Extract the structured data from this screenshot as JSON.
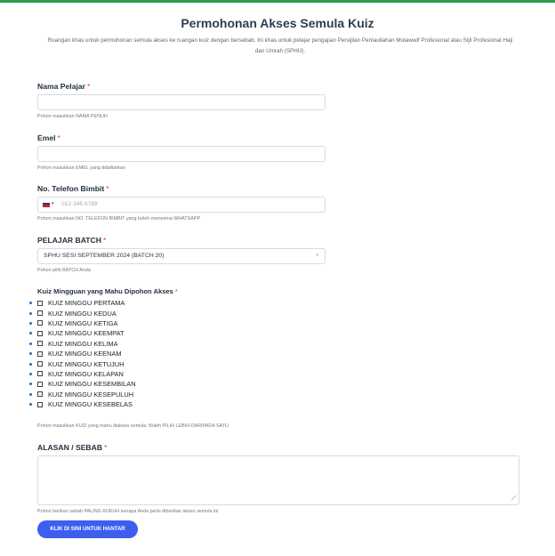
{
  "form": {
    "title": "Permohonan Akses Semula Kuiz",
    "intro": "Ruangan khas untuk permohonan semula akses ke ruangan kuiz dengan bersebab. Ini khas untuk pelajar pengajian Persijilan Pentauliahan Mutawwif Profesional atau Sijil Profesional Haji dan Umrah (SPHU)."
  },
  "fields": {
    "nama": {
      "label": "Nama Pelajar",
      "required": "*",
      "hint": "Pohon masukkan NAMA PENUH",
      "value": ""
    },
    "emel": {
      "label": "Emel",
      "required": "*",
      "hint": "Pohon masukkan EMEL yang didaftarkan",
      "value": ""
    },
    "telefon": {
      "label": "No. Telefon Bimbit",
      "required": "*",
      "placeholder": "012-345 6789",
      "country": "MY",
      "hint": "Pohon masukkan NO. TELEFON BIMBIT yang boleh menerima WHATSAPP"
    },
    "batch": {
      "label": "PELAJAR BATCH",
      "required": "*",
      "selected": "SPHU SESI SEPTEMBER 2024 (BATCH 20)",
      "hint": "Pohon pilih BATCH Anda"
    },
    "kuiz": {
      "label": "Kuiz Mingguan yang Mahu Dipohon Akses",
      "required": "*",
      "options": [
        "KUIZ MINGGU PERTAMA",
        "KUIZ MINGGU KEDUA",
        "KUIZ MINGGU KETIGA",
        "KUIZ MINGGU KEEMPAT",
        "KUIZ MINGGU KELIMA",
        "KUIZ MINGGU KEENAM",
        "KUIZ MINGGU KETUJUH",
        "KUIZ MINGGU KELAPAN",
        "KUIZ MINGGU KESEMBILAN",
        "KUIZ MINGGU KESEPULUH",
        "KUIZ MINGGU KESEBELAS"
      ],
      "hint": "Pohon masukkan KUIZ yang mahu diakses semula. Boleh PILIH LEBIH DARIPADA SATU"
    },
    "alasan": {
      "label": "ALASAN / SEBAB",
      "required": "*",
      "hint": "Pohon berikan sebab PALING KUKUH kenapa Anda perlu diberikan akses semula ini"
    }
  },
  "submit": {
    "label": "KLIK DI SINI UNTUK HANTAR"
  },
  "colors": {
    "accent": "#3c5ff0",
    "required": "#e53935",
    "top_bar": "#2a9d4a"
  }
}
